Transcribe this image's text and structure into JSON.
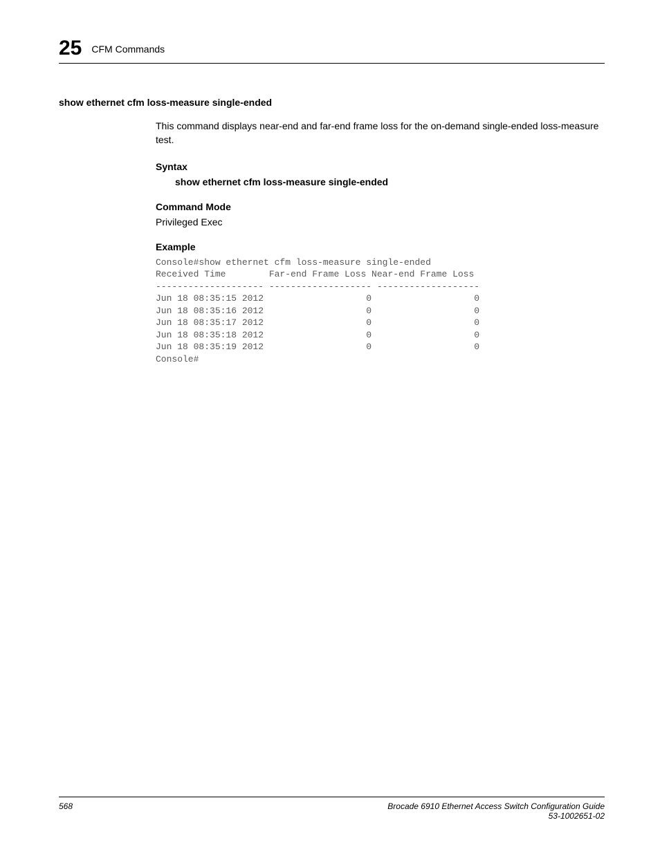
{
  "header": {
    "chapter_number": "25",
    "chapter_title": "CFM Commands"
  },
  "command": {
    "heading": "show ethernet cfm loss-measure single-ended",
    "description": "This command displays near-end and far-end frame loss for the on-demand single-ended loss-measure test.",
    "syntax_label": "Syntax",
    "syntax_text": "show ethernet cfm loss-measure single-ended",
    "mode_label": "Command Mode",
    "mode_text": "Privileged Exec",
    "example_label": "Example",
    "example_output": "Console#show ethernet cfm loss-measure single-ended\nReceived Time        Far-end Frame Loss Near-end Frame Loss\n-------------------- ------------------- -------------------\nJun 18 08:35:15 2012                   0                   0\nJun 18 08:35:16 2012                   0                   0\nJun 18 08:35:17 2012                   0                   0\nJun 18 08:35:18 2012                   0                   0\nJun 18 08:35:19 2012                   0                   0\nConsole#"
  },
  "footer": {
    "page_number": "568",
    "doc_title": "Brocade 6910 Ethernet Access Switch Configuration Guide",
    "doc_id": "53-1002651-02"
  }
}
